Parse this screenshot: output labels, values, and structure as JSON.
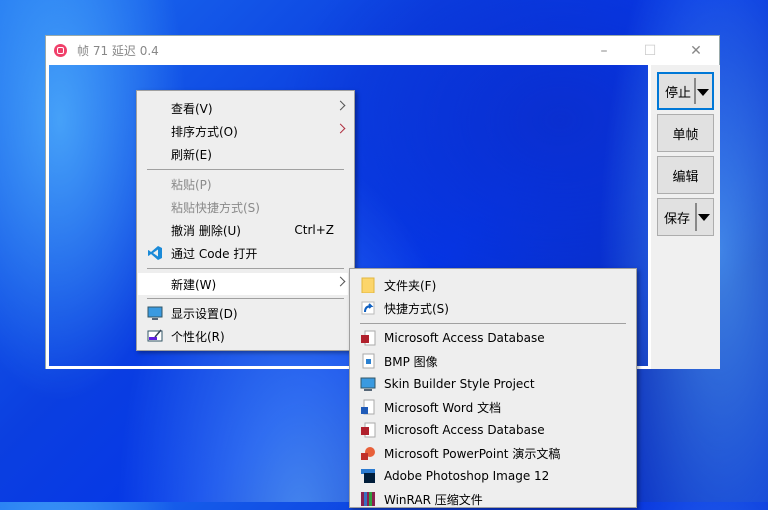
{
  "window": {
    "title": "帧 71 延迟 0.4",
    "minimize": "–",
    "maximize": "☐",
    "close": "✕"
  },
  "panel": {
    "stop": "停止",
    "single_frame": "单帧",
    "edit": "编辑",
    "save": "保存"
  },
  "context_menu": {
    "items": [
      {
        "label": "查看(V)"
      },
      {
        "label": "排序方式(O)"
      },
      {
        "label": "刷新(E)"
      },
      {
        "label": "粘贴(P)"
      },
      {
        "label": "粘贴快捷方式(S)"
      },
      {
        "label": "撤消 删除(U)",
        "shortcut": "Ctrl+Z"
      },
      {
        "label": "通过 Code 打开"
      },
      {
        "label": "新建(W)"
      },
      {
        "label": "显示设置(D)"
      },
      {
        "label": "个性化(R)"
      }
    ]
  },
  "new_submenu": {
    "items": [
      {
        "label": "文件夹(F)",
        "icon": "folder-icon"
      },
      {
        "label": "快捷方式(S)",
        "icon": "shortcut-icon"
      },
      {
        "label": "Microsoft Access Database",
        "icon": "access-icon"
      },
      {
        "label": "BMP 图像",
        "icon": "bmp-icon"
      },
      {
        "label": "Skin Builder Style Project",
        "icon": "monitor-icon"
      },
      {
        "label": "Microsoft Word 文档",
        "icon": "word-icon"
      },
      {
        "label": "Microsoft Access Database",
        "icon": "access-icon"
      },
      {
        "label": "Microsoft PowerPoint 演示文稿",
        "icon": "powerpoint-icon"
      },
      {
        "label": "Adobe Photoshop Image 12",
        "icon": "photoshop-icon"
      },
      {
        "label": "WinRAR 压缩文件",
        "icon": "winrar-icon"
      }
    ]
  }
}
